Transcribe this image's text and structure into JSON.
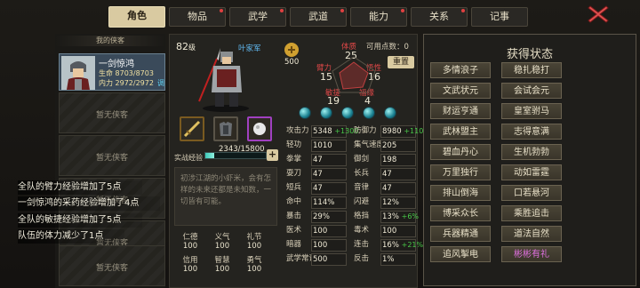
{
  "tabs": [
    {
      "label": "角色",
      "active": true,
      "dot": false
    },
    {
      "label": "物品",
      "active": false,
      "dot": true
    },
    {
      "label": "武学",
      "active": false,
      "dot": true
    },
    {
      "label": "武道",
      "active": false,
      "dot": true
    },
    {
      "label": "能力",
      "active": false,
      "dot": true
    },
    {
      "label": "关系",
      "active": false,
      "dot": true
    },
    {
      "label": "记事",
      "active": false,
      "dot": false
    }
  ],
  "party": {
    "title": "我的侠客",
    "hero": {
      "name": "一剑惊鸿",
      "hp": "生命 8703/8703",
      "mp": "内力 2972/2972",
      "tag": "调"
    },
    "empty_label": "暂无侠客"
  },
  "log": [
    "全队的臂力经验增加了5点",
    "一剑惊鸿的采药经验增加了4点",
    "全队的敏捷经验增加了5点",
    "队伍的体力减少了1点"
  ],
  "character": {
    "level": "82",
    "level_unit": "级",
    "faction": "叶家军",
    "coin": "500",
    "attributes": {
      "tizhi_label": "体质",
      "tizhi": "25",
      "bili_label": "臂力",
      "bili": "15",
      "wuxing_label": "悟性",
      "wuxing": "16",
      "minjie_label": "敏捷",
      "minjie": "19",
      "fuyuan_label": "福缘",
      "fuyuan": "4"
    },
    "points_label": "可用点数：",
    "points": "0",
    "reset_label": "重置",
    "exp_label": "实战经验",
    "exp": "2343/15800",
    "exp_progress": 0.148,
    "description": "初涉江湖的小虾米，会有怎样的未来还都是未知数，一切皆有可能。",
    "virtues": [
      {
        "name": "仁德",
        "value": "100"
      },
      {
        "name": "义气",
        "value": "100"
      },
      {
        "name": "礼节",
        "value": "100"
      },
      {
        "name": "信用",
        "value": "100"
      },
      {
        "name": "智慧",
        "value": "100"
      },
      {
        "name": "勇气",
        "value": "100"
      }
    ],
    "stats_left": [
      {
        "k": "攻击力",
        "v": "5348",
        "b": "+1300"
      },
      {
        "k": "轻功",
        "v": "1010",
        "b": ""
      },
      {
        "k": "拳掌",
        "v": "47",
        "b": ""
      },
      {
        "k": "耍刀",
        "v": "47",
        "b": ""
      },
      {
        "k": "短兵",
        "v": "47",
        "b": ""
      },
      {
        "k": "命中",
        "v": "114%",
        "b": ""
      },
      {
        "k": "暴击",
        "v": "29%",
        "b": ""
      },
      {
        "k": "医术",
        "v": "100",
        "b": ""
      },
      {
        "k": "暗器",
        "v": "100",
        "b": ""
      },
      {
        "k": "武学常识",
        "v": "500",
        "b": ""
      }
    ],
    "stats_right": [
      {
        "k": "防御力",
        "v": "8980",
        "b": "+1100"
      },
      {
        "k": "集气速度",
        "v": "205",
        "b": ""
      },
      {
        "k": "御剑",
        "v": "198",
        "b": ""
      },
      {
        "k": "长兵",
        "v": "47",
        "b": ""
      },
      {
        "k": "音律",
        "v": "47",
        "b": ""
      },
      {
        "k": "闪避",
        "v": "12%",
        "b": ""
      },
      {
        "k": "格挡",
        "v": "13%",
        "b": "+6%"
      },
      {
        "k": "毒术",
        "v": "100",
        "b": ""
      },
      {
        "k": "连击",
        "v": "16%",
        "b": "+21%"
      },
      {
        "k": "反击",
        "v": "1%",
        "b": ""
      }
    ]
  },
  "status_panel": {
    "title": "获得状态",
    "items": [
      "多情浪子",
      "稳扎稳打",
      "文武状元",
      "会试会元",
      "财运亨通",
      "皇室驸马",
      "武林盟主",
      "志得意满",
      "碧血丹心",
      "生机勃勃",
      "万里独行",
      "动如雷霆",
      "排山倒海",
      "口若悬河",
      "博采众长",
      "乘胜追击",
      "兵器精通",
      "道法自然",
      "追风掣电",
      "彬彬有礼"
    ]
  },
  "colors": {
    "accent": "#d9caa1",
    "bonus": "#48c848",
    "close": "#e05050",
    "highlight": "#e070e0"
  }
}
